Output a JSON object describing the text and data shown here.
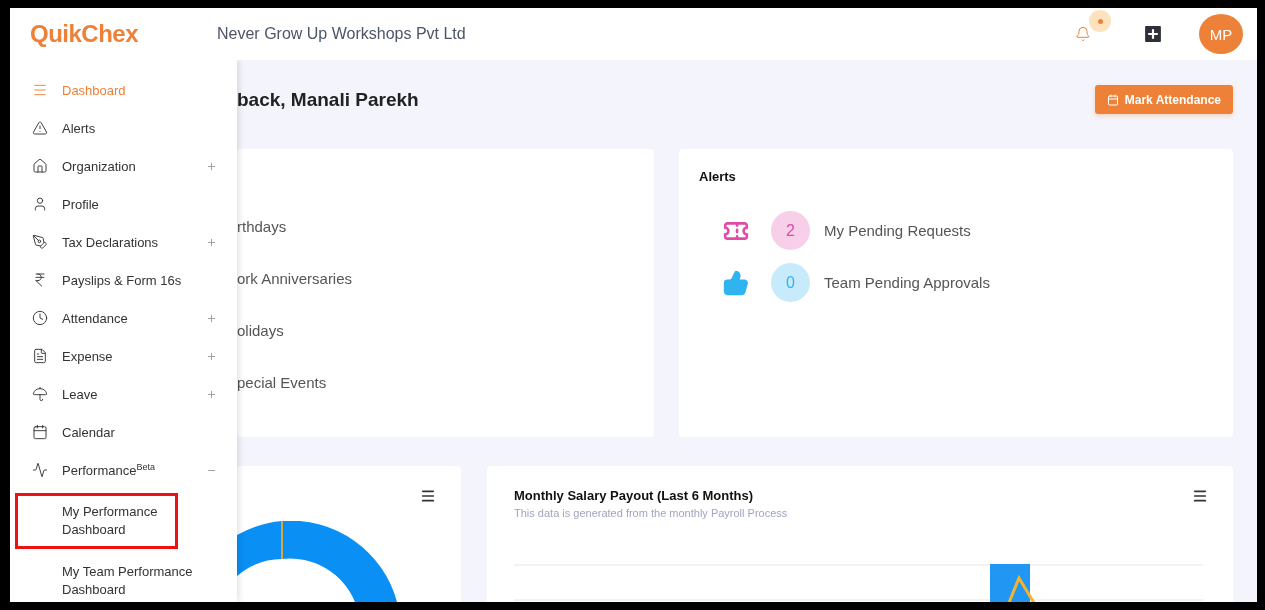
{
  "header": {
    "logo": "QuikChex",
    "company": "Never Grow Up Workshops Pvt Ltd",
    "notification_dot": true,
    "avatar": "MP"
  },
  "sidebar": {
    "items": [
      {
        "label": "Dashboard",
        "selected": true
      },
      {
        "label": "Alerts",
        "selected": false
      },
      {
        "label": "Organization",
        "selected": false,
        "expanded": false
      },
      {
        "label": "Profile",
        "selected": false
      },
      {
        "label": "Tax Declarations",
        "selected": false,
        "expanded": false
      },
      {
        "label": "Payslips & Form 16s",
        "selected": false
      },
      {
        "label": "Attendance",
        "selected": false,
        "expanded": false
      },
      {
        "label": "Expense",
        "selected": false,
        "expanded": false
      },
      {
        "label": "Leave",
        "selected": false,
        "expanded": false
      },
      {
        "label": "Calendar",
        "selected": false
      },
      {
        "label": "Performance",
        "badge": "Beta",
        "selected": false,
        "expanded": true,
        "children": [
          {
            "label": "My Performance Dashboard",
            "highlighted": true
          },
          {
            "label": "My Team Performance Dashboard",
            "highlighted": false
          }
        ]
      }
    ]
  },
  "page": {
    "heading": "back, Manali Parekh",
    "button": "Mark Attendance"
  },
  "events_card": {
    "items": [
      "rthdays",
      "ork Anniversaries",
      "olidays",
      "pecial Events"
    ]
  },
  "alerts_card": {
    "title": "Alerts",
    "rows": [
      {
        "kind": "ticket",
        "count": "2",
        "label": "My Pending Requests",
        "color": "#e04aa8"
      },
      {
        "kind": "thumbs",
        "count": "0",
        "label": "Team Pending Approvals",
        "color": "#2fb4f0"
      }
    ]
  },
  "chart_card": {
    "kind": "donut"
  },
  "salary_card": {
    "title": "Monthly Salary Payout (Last 6 Months)",
    "subtitle": "This data is generated from the monthly Payroll Process"
  }
}
